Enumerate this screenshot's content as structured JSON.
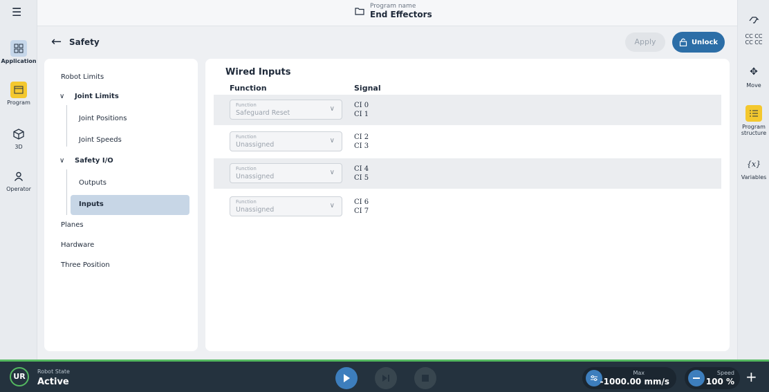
{
  "topbar": {
    "program_small": "Program name",
    "program_name": "End Effectors"
  },
  "left_rail": {
    "items": [
      {
        "label": "Application",
        "icon": "grid-icon"
      },
      {
        "label": "Program",
        "icon": "program-icon"
      },
      {
        "label": "3D",
        "icon": "cube-icon"
      },
      {
        "label": "Operator",
        "icon": "person-icon"
      }
    ]
  },
  "right_rail": {
    "items": [
      {
        "label": "",
        "icon": "hand-icon"
      },
      {
        "label": "CC CC\nCC CC",
        "icon": ""
      },
      {
        "label": "Move",
        "icon": "move-icon"
      },
      {
        "label": "Program structure",
        "icon": "list-icon"
      },
      {
        "label": "Variables",
        "icon": "variables-icon"
      }
    ],
    "cc_line1": "CC CC",
    "cc_line2": "CC CC",
    "move": "Move",
    "prog_struct_1": "Program",
    "prog_struct_2": "structure",
    "variables_icon": "{x}",
    "variables": "Variables"
  },
  "header": {
    "title": "Safety",
    "apply": "Apply",
    "unlock": "Unlock"
  },
  "nav": {
    "robot_limits": "Robot Limits",
    "joint_limits": "Joint Limits",
    "joint_positions": "Joint Positions",
    "joint_speeds": "Joint Speeds",
    "safety_io": "Safety I/O",
    "outputs": "Outputs",
    "inputs": "Inputs",
    "planes": "Planes",
    "hardware": "Hardware",
    "three_position": "Three Position"
  },
  "main": {
    "title": "Wired Inputs",
    "col_function": "Function",
    "col_signal": "Signal",
    "rows": [
      {
        "label": "Function",
        "value": "Safeguard Reset",
        "sig1": "CI 0",
        "sig2": "CI 1"
      },
      {
        "label": "Function",
        "value": "Unassigned",
        "sig1": "CI 2",
        "sig2": "CI 3"
      },
      {
        "label": "Function",
        "value": "Unassigned",
        "sig1": "CI 4",
        "sig2": "CI 5"
      },
      {
        "label": "Function",
        "value": "Unassigned",
        "sig1": "CI 6",
        "sig2": "CI 7"
      }
    ]
  },
  "bottom": {
    "robot_state_label": "Robot State",
    "robot_state": "Active",
    "logo": "UR",
    "max_label": "Max",
    "max_value": "-1000.00 mm/s",
    "speed_label": "Speed",
    "speed_value": "100 %",
    "plus": "+"
  },
  "colors": {
    "accent_blue": "#2c6ea7",
    "highlight_yellow": "#f4c82e",
    "status_green": "#54b860",
    "bottom_bar": "#24323e"
  }
}
